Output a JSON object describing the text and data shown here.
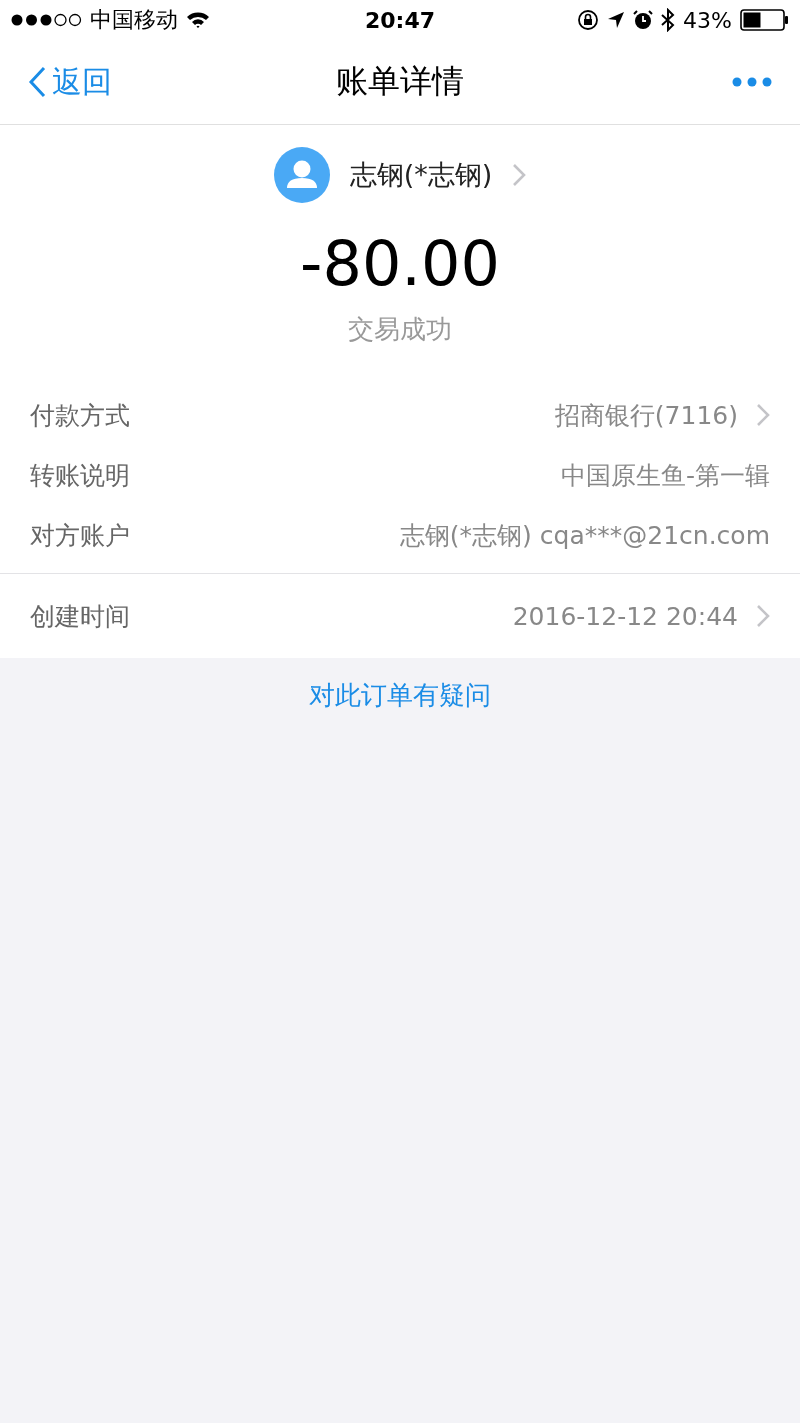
{
  "status_bar": {
    "carrier": "中国移动",
    "time": "20:47",
    "battery": "43%"
  },
  "nav": {
    "back": "返回",
    "title": "账单详情"
  },
  "payee": {
    "name": "志钢(*志钢)",
    "chevron": true
  },
  "amount": "-80.00",
  "status": "交易成功",
  "groups": [
    {
      "rows": [
        {
          "label": "付款方式",
          "value": "招商银行(7116)",
          "chevron": true
        },
        {
          "label": "转账说明",
          "value": "中国原生鱼-第一辑",
          "chevron": false
        },
        {
          "label": "对方账户",
          "value": "志钢(*志钢) cqa***@21cn.com",
          "chevron": false
        }
      ]
    },
    {
      "rows": [
        {
          "label": "创建时间",
          "value": "2016-12-12 20:44",
          "chevron": true
        }
      ]
    }
  ],
  "question_link": "对此订单有疑问"
}
